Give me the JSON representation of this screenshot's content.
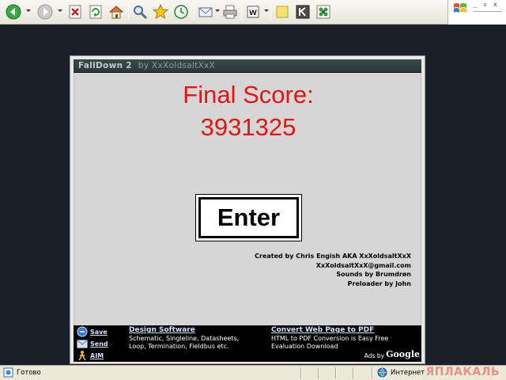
{
  "toolbar": {
    "icons": [
      "back-icon",
      "forward-icon",
      "stop-icon",
      "refresh-icon",
      "home-icon",
      "search-icon",
      "favorites-icon",
      "history-icon",
      "mail-icon",
      "print-icon",
      "word-icon",
      "notes-icon",
      "k-icon",
      "messenger-icon"
    ]
  },
  "game": {
    "title": "FallDown 2",
    "byline": "by XxXoldsaltXxX",
    "score_label": "Final Score:",
    "score_value": "3931325",
    "enter_label": "Enter",
    "credits": [
      "Created by Chris Engish AKA XxXoldsaltXxX",
      "XxXoldsaltXxX@gmail.com",
      "Sounds by Brumdrøn",
      "Preloader by John"
    ],
    "colors": {
      "score": "#e41414",
      "stage": "#d6d6d6"
    }
  },
  "ad": {
    "side": [
      {
        "label": "Save",
        "icon": "save-icon"
      },
      {
        "label": "Send",
        "icon": "send-icon"
      },
      {
        "label": "AIM",
        "icon": "aim-icon"
      }
    ],
    "col1_head": "Design Software",
    "col1_body": [
      "Schematic, Singleline, Datasheets,",
      "Loop, Termination, Fieldbus etc."
    ],
    "col2_head": "Convert Web Page to PDF",
    "col2_body": [
      "HTML to PDF Conversion is Easy Free",
      "Evaluation Download"
    ],
    "ads_by": "Ads by",
    "google": "Google"
  },
  "status": {
    "ready": "Готово",
    "zone": "Интернет",
    "watermark": "ЯПЛАКАЛЬ"
  }
}
